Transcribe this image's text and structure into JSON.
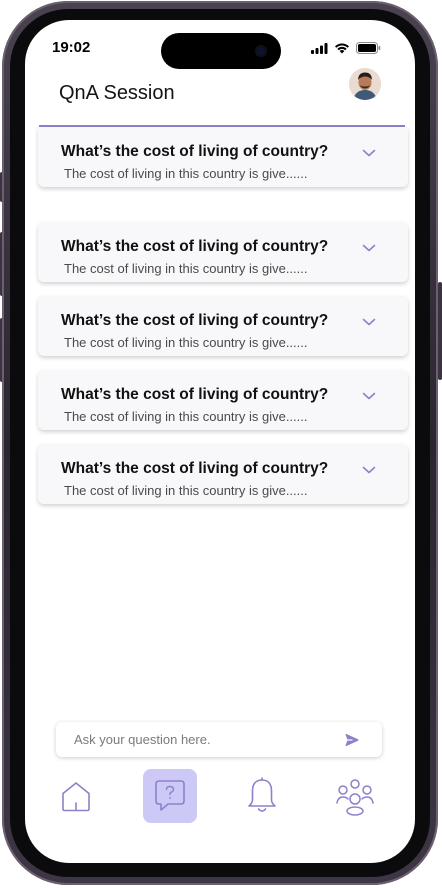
{
  "status_bar": {
    "time": "19:02"
  },
  "header": {
    "title": "QnA Session"
  },
  "qna_items": [
    {
      "question": "What’s the cost of living of country?",
      "answer": "The cost of living in this country is give......"
    },
    {
      "question": "What’s the cost of living of country?",
      "answer": "The cost of living in this country is give......"
    },
    {
      "question": "What’s the cost of living of country?",
      "answer": "The cost of living in this country is give......"
    },
    {
      "question": "What’s the cost of living of country?",
      "answer": "The cost of living in this country is give......"
    },
    {
      "question": "What’s the cost of living of country?",
      "answer": "The cost of living in this country is give......"
    }
  ],
  "ask": {
    "placeholder": "Ask your question here."
  },
  "bottom_nav": [
    {
      "icon": "home-icon",
      "active": false
    },
    {
      "icon": "question-chat-icon",
      "active": true
    },
    {
      "icon": "bell-icon",
      "active": false
    },
    {
      "icon": "community-icon",
      "active": false
    }
  ],
  "colors": {
    "accent": "#8b82c9",
    "active_tab_bg": "#cdc9f6"
  }
}
